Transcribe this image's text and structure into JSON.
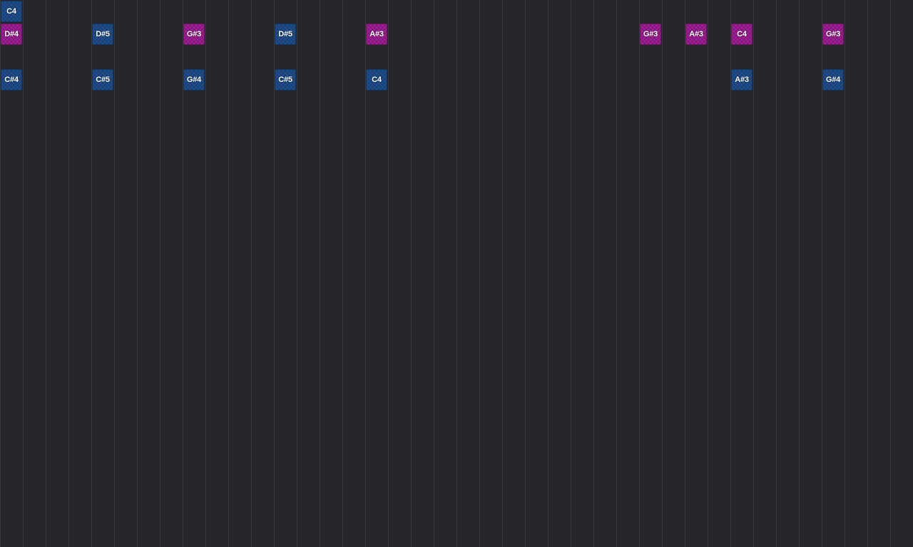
{
  "colors": {
    "background": "#262628",
    "grid_line": "#3a3a3c",
    "note_blue": "#1f4f8f",
    "note_magenta": "#a31f9a"
  },
  "notes": [
    {
      "label": "C4",
      "color": "blue",
      "col": 0,
      "row": 0
    },
    {
      "label": "D#4",
      "color": "magenta",
      "col": 0,
      "row": 1
    },
    {
      "label": "C#4",
      "color": "blue",
      "col": 0,
      "row": 3
    },
    {
      "label": "D#5",
      "color": "blue",
      "col": 4,
      "row": 1
    },
    {
      "label": "C#5",
      "color": "blue",
      "col": 4,
      "row": 3
    },
    {
      "label": "G#3",
      "color": "magenta",
      "col": 8,
      "row": 1
    },
    {
      "label": "G#4",
      "color": "blue",
      "col": 8,
      "row": 3
    },
    {
      "label": "D#5",
      "color": "blue",
      "col": 12,
      "row": 1
    },
    {
      "label": "C#5",
      "color": "blue",
      "col": 12,
      "row": 3
    },
    {
      "label": "A#3",
      "color": "magenta",
      "col": 16,
      "row": 1
    },
    {
      "label": "C4",
      "color": "blue",
      "col": 16,
      "row": 3
    },
    {
      "label": "G#3",
      "color": "magenta",
      "col": 28,
      "row": 1
    },
    {
      "label": "A#3",
      "color": "magenta",
      "col": 30,
      "row": 1
    },
    {
      "label": "C4",
      "color": "magenta",
      "col": 32,
      "row": 1
    },
    {
      "label": "A#3",
      "color": "blue",
      "col": 32,
      "row": 3
    },
    {
      "label": "G#3",
      "color": "magenta",
      "col": 36,
      "row": 1
    },
    {
      "label": "G#4",
      "color": "blue",
      "col": 36,
      "row": 3
    }
  ]
}
